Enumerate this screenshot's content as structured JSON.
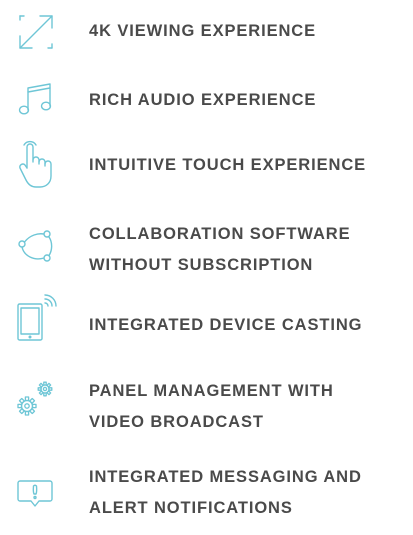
{
  "accent_color": "#6ec6d6",
  "text_color": "#4a4a4a",
  "features": [
    {
      "icon": "expand-arrows-icon",
      "lines": [
        "4K VIEWING EXPERIENCE"
      ]
    },
    {
      "icon": "music-note-icon",
      "lines": [
        "RICH AUDIO EXPERIENCE"
      ]
    },
    {
      "icon": "touch-hand-icon",
      "lines": [
        "INTUITIVE TOUCH EXPERIENCE"
      ]
    },
    {
      "icon": "collaboration-network-icon",
      "lines": [
        "COLLABORATION SOFTWARE",
        "WITHOUT SUBSCRIPTION"
      ]
    },
    {
      "icon": "tablet-casting-icon",
      "lines": [
        "INTEGRATED DEVICE CASTING"
      ]
    },
    {
      "icon": "gears-icon",
      "lines": [
        "PANEL MANAGEMENT WITH",
        "VIDEO BROADCAST"
      ]
    },
    {
      "icon": "alert-message-icon",
      "lines": [
        "INTEGRATED MESSAGING AND",
        "ALERT NOTIFICATIONS"
      ]
    }
  ]
}
